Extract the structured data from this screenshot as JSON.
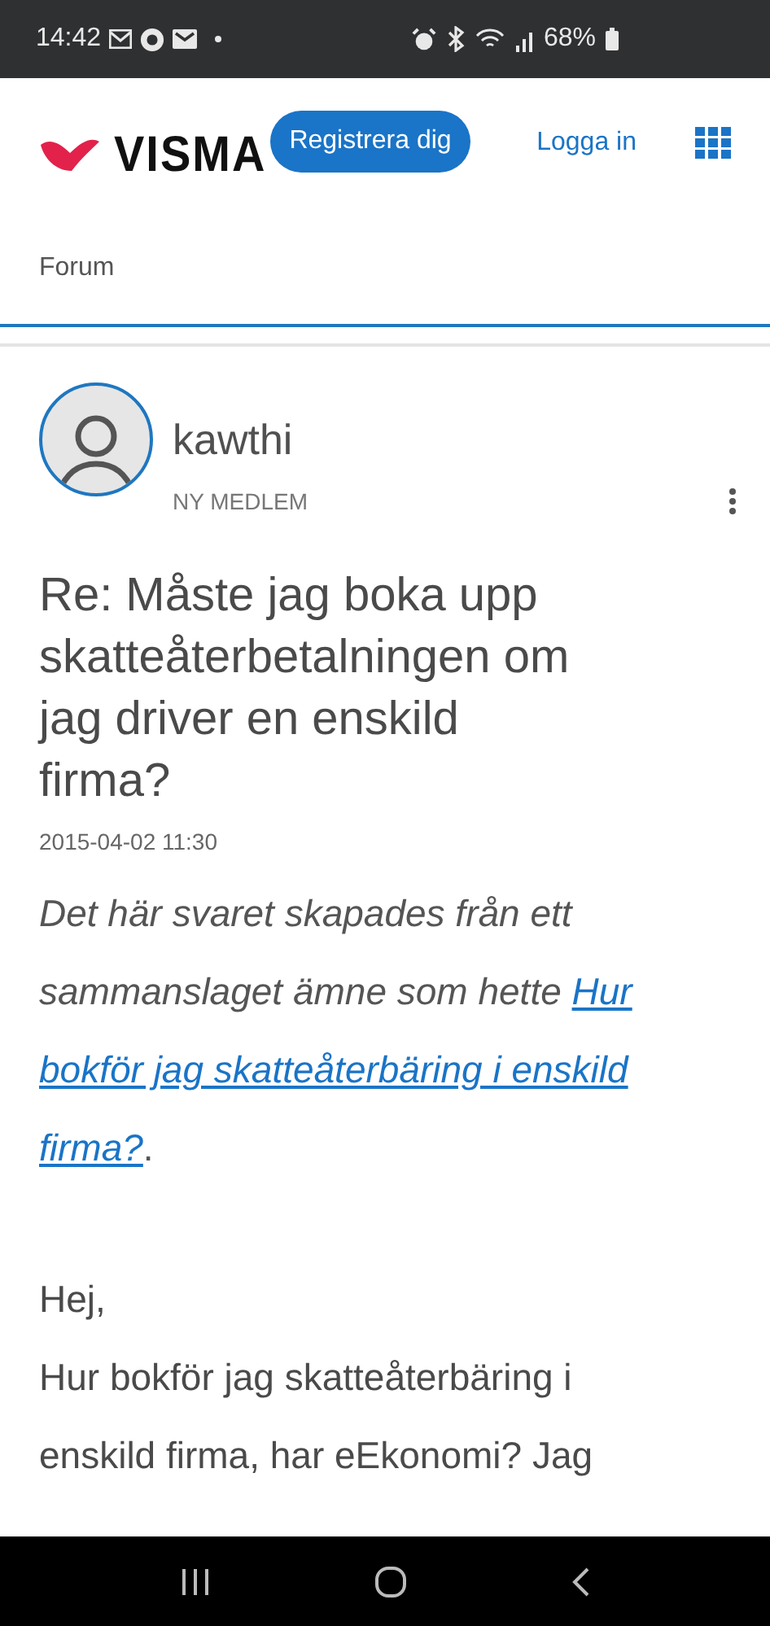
{
  "status_bar": {
    "time": "14:42",
    "battery": "68%"
  },
  "header": {
    "logo": "VISMA",
    "register_button": "Registrera dig",
    "login_link": "Logga in",
    "breadcrumb": "Forum"
  },
  "post": {
    "author": "kawthi",
    "rank": "NY MEDLEM",
    "title": "Re: Måste jag boka upp skatteåterbetalningen om jag driver en enskild firma?",
    "date": "2015-04-02 11:30",
    "merge_note": "Det här svaret skapades från ett sammanslaget ämne som hette",
    "merge_link": "Hur bokför jag skatteåterbäring i enskild firma?",
    "merge_end": ".",
    "paragraphs": [
      "Hej,",
      "Hur bokför jag skatteåterbäring i enskild firma, har eEkonomi? Jag"
    ]
  }
}
